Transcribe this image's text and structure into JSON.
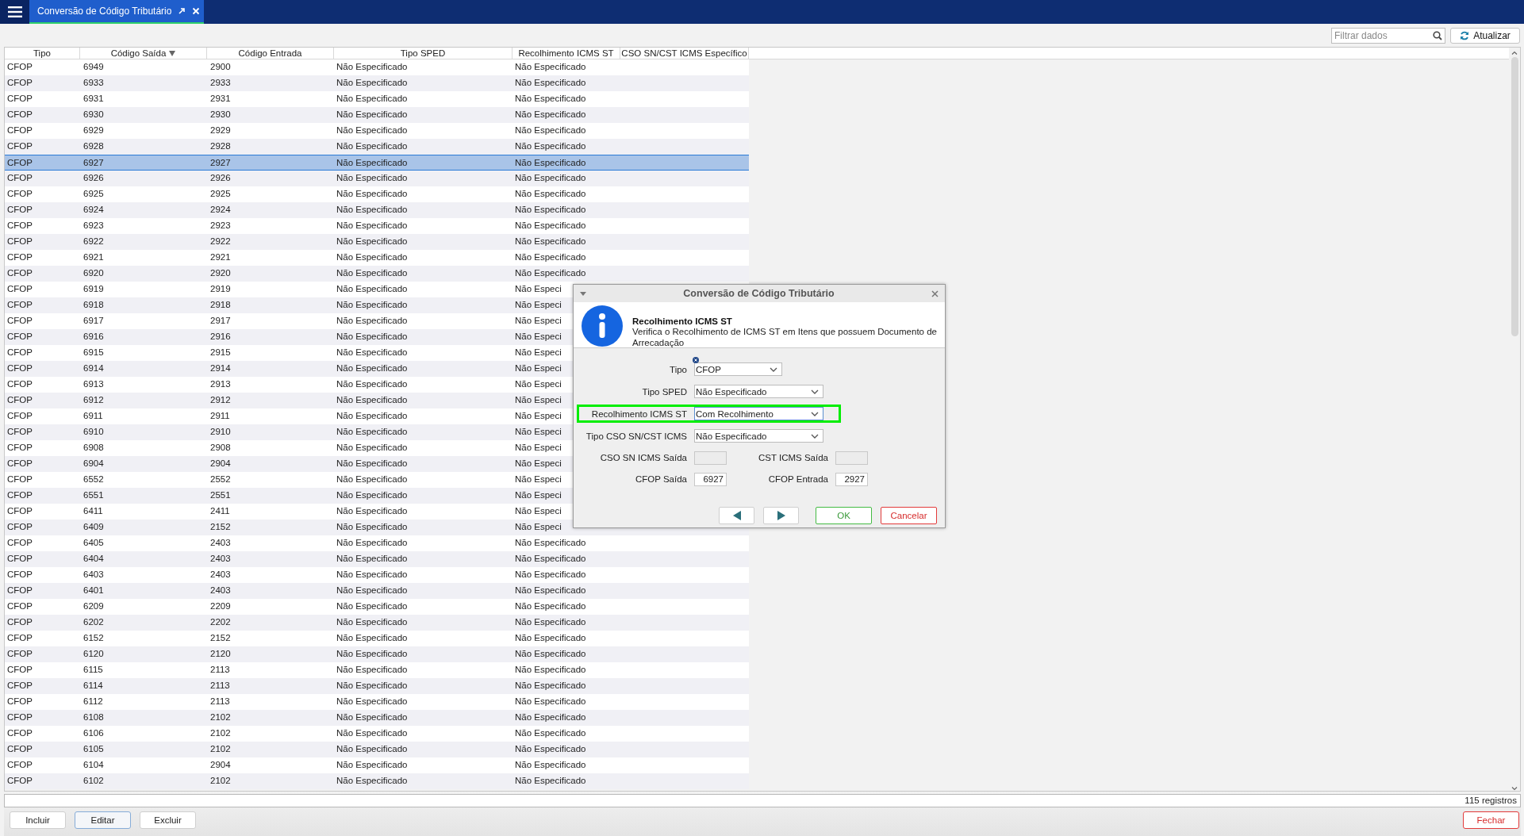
{
  "app_bar": {
    "tab": {
      "title": "Conversão de Código Tributário",
      "selected": true
    }
  },
  "toolbar": {
    "filter": {
      "placeholder": "Filtrar dados"
    },
    "refresh_button": "Atualizar"
  },
  "table": {
    "columns": [
      {
        "label": "Tipo",
        "sorted": false
      },
      {
        "label": "Código Saída",
        "sorted": true
      },
      {
        "label": "Código Entrada",
        "sorted": false
      },
      {
        "label": "Tipo SPED",
        "sorted": false
      },
      {
        "label": "Recolhimento ICMS ST",
        "sorted": false
      },
      {
        "label": "CSO SN/CST ICMS Específico",
        "sorted": false
      }
    ],
    "rows": [
      {
        "cells": [
          "CFOP",
          "6949",
          "2900",
          "Não Especificado",
          "Não Especificado"
        ],
        "selected": false
      },
      {
        "cells": [
          "CFOP",
          "6933",
          "2933",
          "Não Especificado",
          "Não Especificado"
        ],
        "selected": false
      },
      {
        "cells": [
          "CFOP",
          "6931",
          "2931",
          "Não Especificado",
          "Não Especificado"
        ],
        "selected": false
      },
      {
        "cells": [
          "CFOP",
          "6930",
          "2930",
          "Não Especificado",
          "Não Especificado"
        ],
        "selected": false
      },
      {
        "cells": [
          "CFOP",
          "6929",
          "2929",
          "Não Especificado",
          "Não Especificado"
        ],
        "selected": false
      },
      {
        "cells": [
          "CFOP",
          "6928",
          "2928",
          "Não Especificado",
          "Não Especificado"
        ],
        "selected": false
      },
      {
        "cells": [
          "CFOP",
          "6927",
          "2927",
          "Não Especificado",
          "Não Especificado"
        ],
        "selected": true
      },
      {
        "cells": [
          "CFOP",
          "6926",
          "2926",
          "Não Especificado",
          "Não Especificado"
        ],
        "selected": false
      },
      {
        "cells": [
          "CFOP",
          "6925",
          "2925",
          "Não Especificado",
          "Não Especificado"
        ],
        "selected": false
      },
      {
        "cells": [
          "CFOP",
          "6924",
          "2924",
          "Não Especificado",
          "Não Especificado"
        ],
        "selected": false
      },
      {
        "cells": [
          "CFOP",
          "6923",
          "2923",
          "Não Especificado",
          "Não Especificado"
        ],
        "selected": false
      },
      {
        "cells": [
          "CFOP",
          "6922",
          "2922",
          "Não Especificado",
          "Não Especificado"
        ],
        "selected": false
      },
      {
        "cells": [
          "CFOP",
          "6921",
          "2921",
          "Não Especificado",
          "Não Especificado"
        ],
        "selected": false
      },
      {
        "cells": [
          "CFOP",
          "6920",
          "2920",
          "Não Especificado",
          "Não Especificado"
        ],
        "selected": false
      },
      {
        "cells": [
          "CFOP",
          "6919",
          "2919",
          "Não Especificado",
          "Não Especi"
        ],
        "selected": false
      },
      {
        "cells": [
          "CFOP",
          "6918",
          "2918",
          "Não Especificado",
          "Não Especi"
        ],
        "selected": false
      },
      {
        "cells": [
          "CFOP",
          "6917",
          "2917",
          "Não Especificado",
          "Não Especi"
        ],
        "selected": false
      },
      {
        "cells": [
          "CFOP",
          "6916",
          "2916",
          "Não Especificado",
          "Não Especi"
        ],
        "selected": false
      },
      {
        "cells": [
          "CFOP",
          "6915",
          "2915",
          "Não Especificado",
          "Não Especi"
        ],
        "selected": false
      },
      {
        "cells": [
          "CFOP",
          "6914",
          "2914",
          "Não Especificado",
          "Não Especi"
        ],
        "selected": false
      },
      {
        "cells": [
          "CFOP",
          "6913",
          "2913",
          "Não Especificado",
          "Não Especi"
        ],
        "selected": false
      },
      {
        "cells": [
          "CFOP",
          "6912",
          "2912",
          "Não Especificado",
          "Não Especi"
        ],
        "selected": false
      },
      {
        "cells": [
          "CFOP",
          "6911",
          "2911",
          "Não Especificado",
          "Não Especi"
        ],
        "selected": false
      },
      {
        "cells": [
          "CFOP",
          "6910",
          "2910",
          "Não Especificado",
          "Não Especi"
        ],
        "selected": false
      },
      {
        "cells": [
          "CFOP",
          "6908",
          "2908",
          "Não Especificado",
          "Não Especi"
        ],
        "selected": false
      },
      {
        "cells": [
          "CFOP",
          "6904",
          "2904",
          "Não Especificado",
          "Não Especi"
        ],
        "selected": false
      },
      {
        "cells": [
          "CFOP",
          "6552",
          "2552",
          "Não Especificado",
          "Não Especi"
        ],
        "selected": false
      },
      {
        "cells": [
          "CFOP",
          "6551",
          "2551",
          "Não Especificado",
          "Não Especi"
        ],
        "selected": false
      },
      {
        "cells": [
          "CFOP",
          "6411",
          "2411",
          "Não Especificado",
          "Não Especi"
        ],
        "selected": false
      },
      {
        "cells": [
          "CFOP",
          "6409",
          "2152",
          "Não Especificado",
          "Não Especi"
        ],
        "selected": false
      },
      {
        "cells": [
          "CFOP",
          "6405",
          "2403",
          "Não Especificado",
          "Não Especificado"
        ],
        "selected": false
      },
      {
        "cells": [
          "CFOP",
          "6404",
          "2403",
          "Não Especificado",
          "Não Especificado"
        ],
        "selected": false
      },
      {
        "cells": [
          "CFOP",
          "6403",
          "2403",
          "Não Especificado",
          "Não Especificado"
        ],
        "selected": false
      },
      {
        "cells": [
          "CFOP",
          "6401",
          "2403",
          "Não Especificado",
          "Não Especificado"
        ],
        "selected": false
      },
      {
        "cells": [
          "CFOP",
          "6209",
          "2209",
          "Não Especificado",
          "Não Especificado"
        ],
        "selected": false
      },
      {
        "cells": [
          "CFOP",
          "6202",
          "2202",
          "Não Especificado",
          "Não Especificado"
        ],
        "selected": false
      },
      {
        "cells": [
          "CFOP",
          "6152",
          "2152",
          "Não Especificado",
          "Não Especificado"
        ],
        "selected": false
      },
      {
        "cells": [
          "CFOP",
          "6120",
          "2120",
          "Não Especificado",
          "Não Especificado"
        ],
        "selected": false
      },
      {
        "cells": [
          "CFOP",
          "6115",
          "2113",
          "Não Especificado",
          "Não Especificado"
        ],
        "selected": false
      },
      {
        "cells": [
          "CFOP",
          "6114",
          "2113",
          "Não Especificado",
          "Não Especificado"
        ],
        "selected": false
      },
      {
        "cells": [
          "CFOP",
          "6112",
          "2113",
          "Não Especificado",
          "Não Especificado"
        ],
        "selected": false
      },
      {
        "cells": [
          "CFOP",
          "6108",
          "2102",
          "Não Especificado",
          "Não Especificado"
        ],
        "selected": false
      },
      {
        "cells": [
          "CFOP",
          "6106",
          "2102",
          "Não Especificado",
          "Não Especificado"
        ],
        "selected": false
      },
      {
        "cells": [
          "CFOP",
          "6105",
          "2102",
          "Não Especificado",
          "Não Especificado"
        ],
        "selected": false
      },
      {
        "cells": [
          "CFOP",
          "6104",
          "2904",
          "Não Especificado",
          "Não Especificado"
        ],
        "selected": false
      },
      {
        "cells": [
          "CFOP",
          "6102",
          "2102",
          "Não Especificado",
          "Não Especificado"
        ],
        "selected": false
      }
    ]
  },
  "status_bar": {
    "count": "115 registros"
  },
  "buttons": [
    {
      "label": "Incluir",
      "focused": false
    },
    {
      "label": "Editar",
      "focused": true
    },
    {
      "label": "Excluir",
      "focused": false
    }
  ],
  "close_button": "Fechar",
  "dialog": {
    "title": "Conversão de Código Tributário",
    "heading": "Recolhimento ICMS ST",
    "description": "Verifica o Recolhimento de ICMS ST em Itens que possuem Documento de Arrecadação",
    "fields": [
      {
        "kind": "select",
        "label": "Tipo",
        "value": "CFOP",
        "required": true,
        "highlighted": false,
        "focused": false
      },
      {
        "kind": "select",
        "label": "Tipo SPED",
        "value": "Não Especificado",
        "required": false,
        "highlighted": false,
        "focused": false
      },
      {
        "kind": "select",
        "label": "Recolhimento ICMS ST",
        "value": "Com Recolhimento",
        "required": false,
        "highlighted": true,
        "focused": true
      },
      {
        "kind": "select",
        "label": "Tipo CSO SN/CST ICMS",
        "value": "Não Especificado",
        "required": false,
        "highlighted": false,
        "focused": false
      },
      {
        "kind": "pair",
        "items": [
          {
            "label": "CSO SN ICMS Saída",
            "disabled": true
          },
          {
            "label": "CST ICMS Saída",
            "disabled": true
          }
        ]
      },
      {
        "kind": "pair",
        "items": [
          {
            "label": "CFOP Saída",
            "value": "6927",
            "disabled": false
          },
          {
            "label": "CFOP Entrada",
            "value": "2927",
            "disabled": false
          }
        ]
      }
    ],
    "buttons": [
      {
        "kind": "prev"
      },
      {
        "kind": "next"
      },
      {
        "kind": "ok",
        "label": "OK"
      },
      {
        "kind": "cancel",
        "label": "Cancelar"
      }
    ]
  }
}
